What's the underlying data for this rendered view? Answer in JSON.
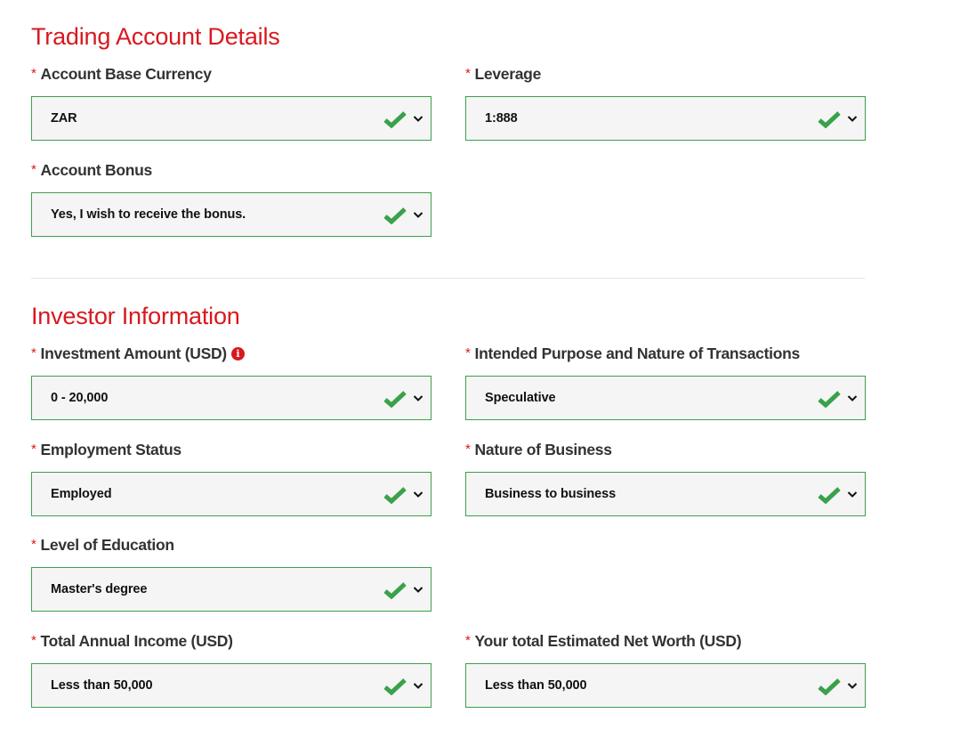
{
  "sections": {
    "trading": {
      "title": "Trading Account Details",
      "fields": {
        "base_currency": {
          "label": "Account Base Currency",
          "value": "ZAR",
          "required_mark": "*"
        },
        "leverage": {
          "label": "Leverage",
          "value": "1:888",
          "required_mark": "*"
        },
        "bonus": {
          "label": "Account Bonus",
          "value": "Yes, I wish to receive the bonus.",
          "required_mark": "*"
        }
      }
    },
    "investor": {
      "title": "Investor Information",
      "fields": {
        "investment_amount": {
          "label": "Investment Amount (USD)",
          "value": "0 - 20,000",
          "required_mark": "*",
          "info_icon": "i"
        },
        "purpose": {
          "label": "Intended Purpose and Nature of Transactions",
          "value": "Speculative",
          "required_mark": "*"
        },
        "employment": {
          "label": "Employment Status",
          "value": "Employed",
          "required_mark": "*"
        },
        "business": {
          "label": "Nature of Business",
          "value": "Business to business",
          "required_mark": "*"
        },
        "education": {
          "label": "Level of Education",
          "value": "Master's degree",
          "required_mark": "*"
        },
        "income": {
          "label": "Total Annual Income (USD)",
          "value": "Less than 50,000",
          "required_mark": "*"
        },
        "net_worth": {
          "label": "Your total Estimated Net Worth (USD)",
          "value": "Less than 50,000",
          "required_mark": "*"
        }
      }
    }
  },
  "icons": {
    "valid": "check-icon",
    "dropdown": "chevron-down-icon",
    "info": "info-icon"
  },
  "colors": {
    "accent_red": "#d7191f",
    "valid_green": "#3aa14b",
    "field_bg": "#f5f5f5"
  }
}
